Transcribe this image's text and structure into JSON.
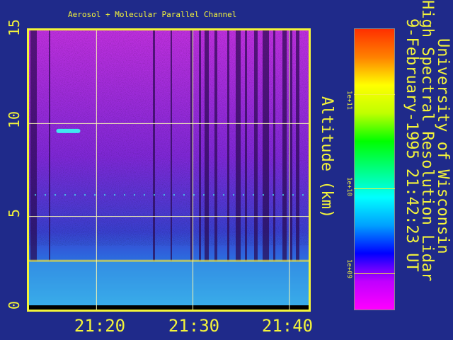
{
  "chart_data": {
    "type": "heatmap",
    "title": "Aerosol + Molecular Parallel Channel",
    "ylabel": "Altitude (km)",
    "xlabel": "",
    "ylim": [
      0,
      15
    ],
    "xlim": [
      "21:13",
      "21:42"
    ],
    "y_ticks": [
      "0",
      "5",
      "10",
      "15"
    ],
    "x_ticks": [
      "21:20",
      "21:30",
      "21:40"
    ],
    "grid": true,
    "colorbar": {
      "scale": "log",
      "range": [
        500000000.0,
        1000000000000.0
      ],
      "tick_labels": [
        "1e+09",
        "1e+10",
        "1e+11"
      ],
      "ticks": [
        1000000000.0,
        10000000000.0,
        100000000000.0
      ],
      "colormap": [
        "#ff00ff",
        "#c000ff",
        "#0000ff",
        "#00a0ff",
        "#00ffff",
        "#00ff80",
        "#00ff00",
        "#c0ff00",
        "#ffff00",
        "#ff8000",
        "#ff3000"
      ]
    },
    "features": {
      "cloud_base_km": 2.6,
      "boundary_layer_top_km": 2.6,
      "high_cloud": {
        "time": "21:17",
        "altitude_km": 9.6
      },
      "thin_layer_altitude_km": 6.2
    },
    "colors": {
      "background": "#1f2a8a",
      "axis": "#f4f43a",
      "upper": "#a020d0",
      "lower": "#3080e0",
      "boundary": "#40d0e8"
    }
  },
  "side_text": {
    "line1": "University of Wisconsin",
    "line2": "High Spectral Resolution Lidar",
    "line3": "9-February-1995 21:42:23 UT"
  }
}
